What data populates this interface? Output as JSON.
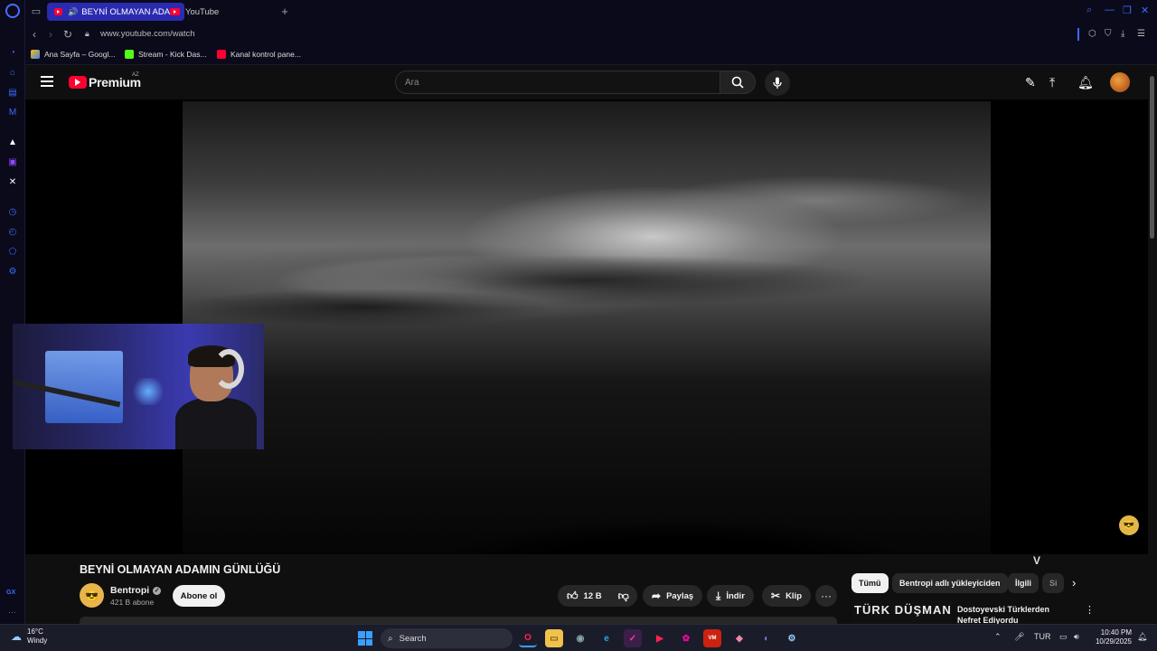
{
  "browser": {
    "tabs": [
      {
        "label": "BEYNİ OLMAYAN ADAM",
        "active": true
      },
      {
        "label": "YouTube",
        "active": false
      }
    ],
    "url": "www.youtube.com/watch",
    "bookmarks": [
      {
        "label": "Ana Sayfa – Googl..."
      },
      {
        "label": "Stream - Kick Das..."
      },
      {
        "label": "Kanal kontrol pane..."
      }
    ],
    "sidebar_label": "GX"
  },
  "youtube": {
    "brand": "Premium",
    "region": "AZ",
    "search_placeholder": "Ara"
  },
  "video": {
    "title": "BEYNİ OLMAYAN ADAMIN GÜNLÜĞÜ",
    "channel_name": "Bentropi",
    "subscribers": "421 B abone",
    "subscribe_label": "Abone ol",
    "likes": "12 B",
    "share_label": "Paylaş",
    "download_label": "İndir",
    "clip_label": "Klip"
  },
  "sidebar_feed": {
    "chips": [
      "Tümü",
      "Bentropi adlı yükleyiciden",
      "İlgili",
      "Si"
    ],
    "recommended": [
      {
        "thumb_text": "TÜRK DÜŞMANI",
        "title": "Dostoyevski Türklerden Nefret Ediyordu"
      }
    ],
    "v_logo": "V"
  },
  "taskbar": {
    "weather_temp": "16°C",
    "weather_desc": "Windy",
    "search_label": "Search",
    "lang": "TUR",
    "time": "10:40 PM",
    "date": "10/29/2025"
  },
  "colors": {
    "yt_red": "#ff0033",
    "gx_accent": "#3b6cff",
    "active_tab": "#2b2bb0"
  }
}
